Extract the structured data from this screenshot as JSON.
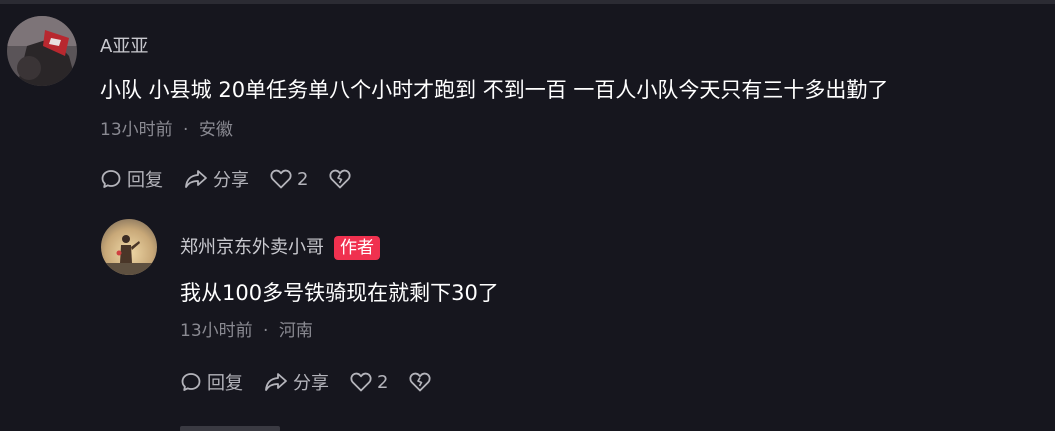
{
  "comment": {
    "username": "A亚亚",
    "text": "小队 小县城 20单任务单八个小时才跑到 不到一百 一百人小队今天只有三十多出勤了",
    "time": "13小时前",
    "location": "安徽",
    "reply_label": "回复",
    "share_label": "分享",
    "like_count": "2"
  },
  "reply": {
    "username": "郑州京东外卖小哥",
    "badge": "作者",
    "text": "我从100多号铁骑现在就剩下30了",
    "time": "13小时前",
    "location": "河南",
    "reply_label": "回复",
    "share_label": "分享",
    "like_count": "2"
  },
  "meta_separator": "·",
  "colors": {
    "background": "#16161e",
    "badge": "#f0314f",
    "secondary_text": "#8a8a92"
  }
}
